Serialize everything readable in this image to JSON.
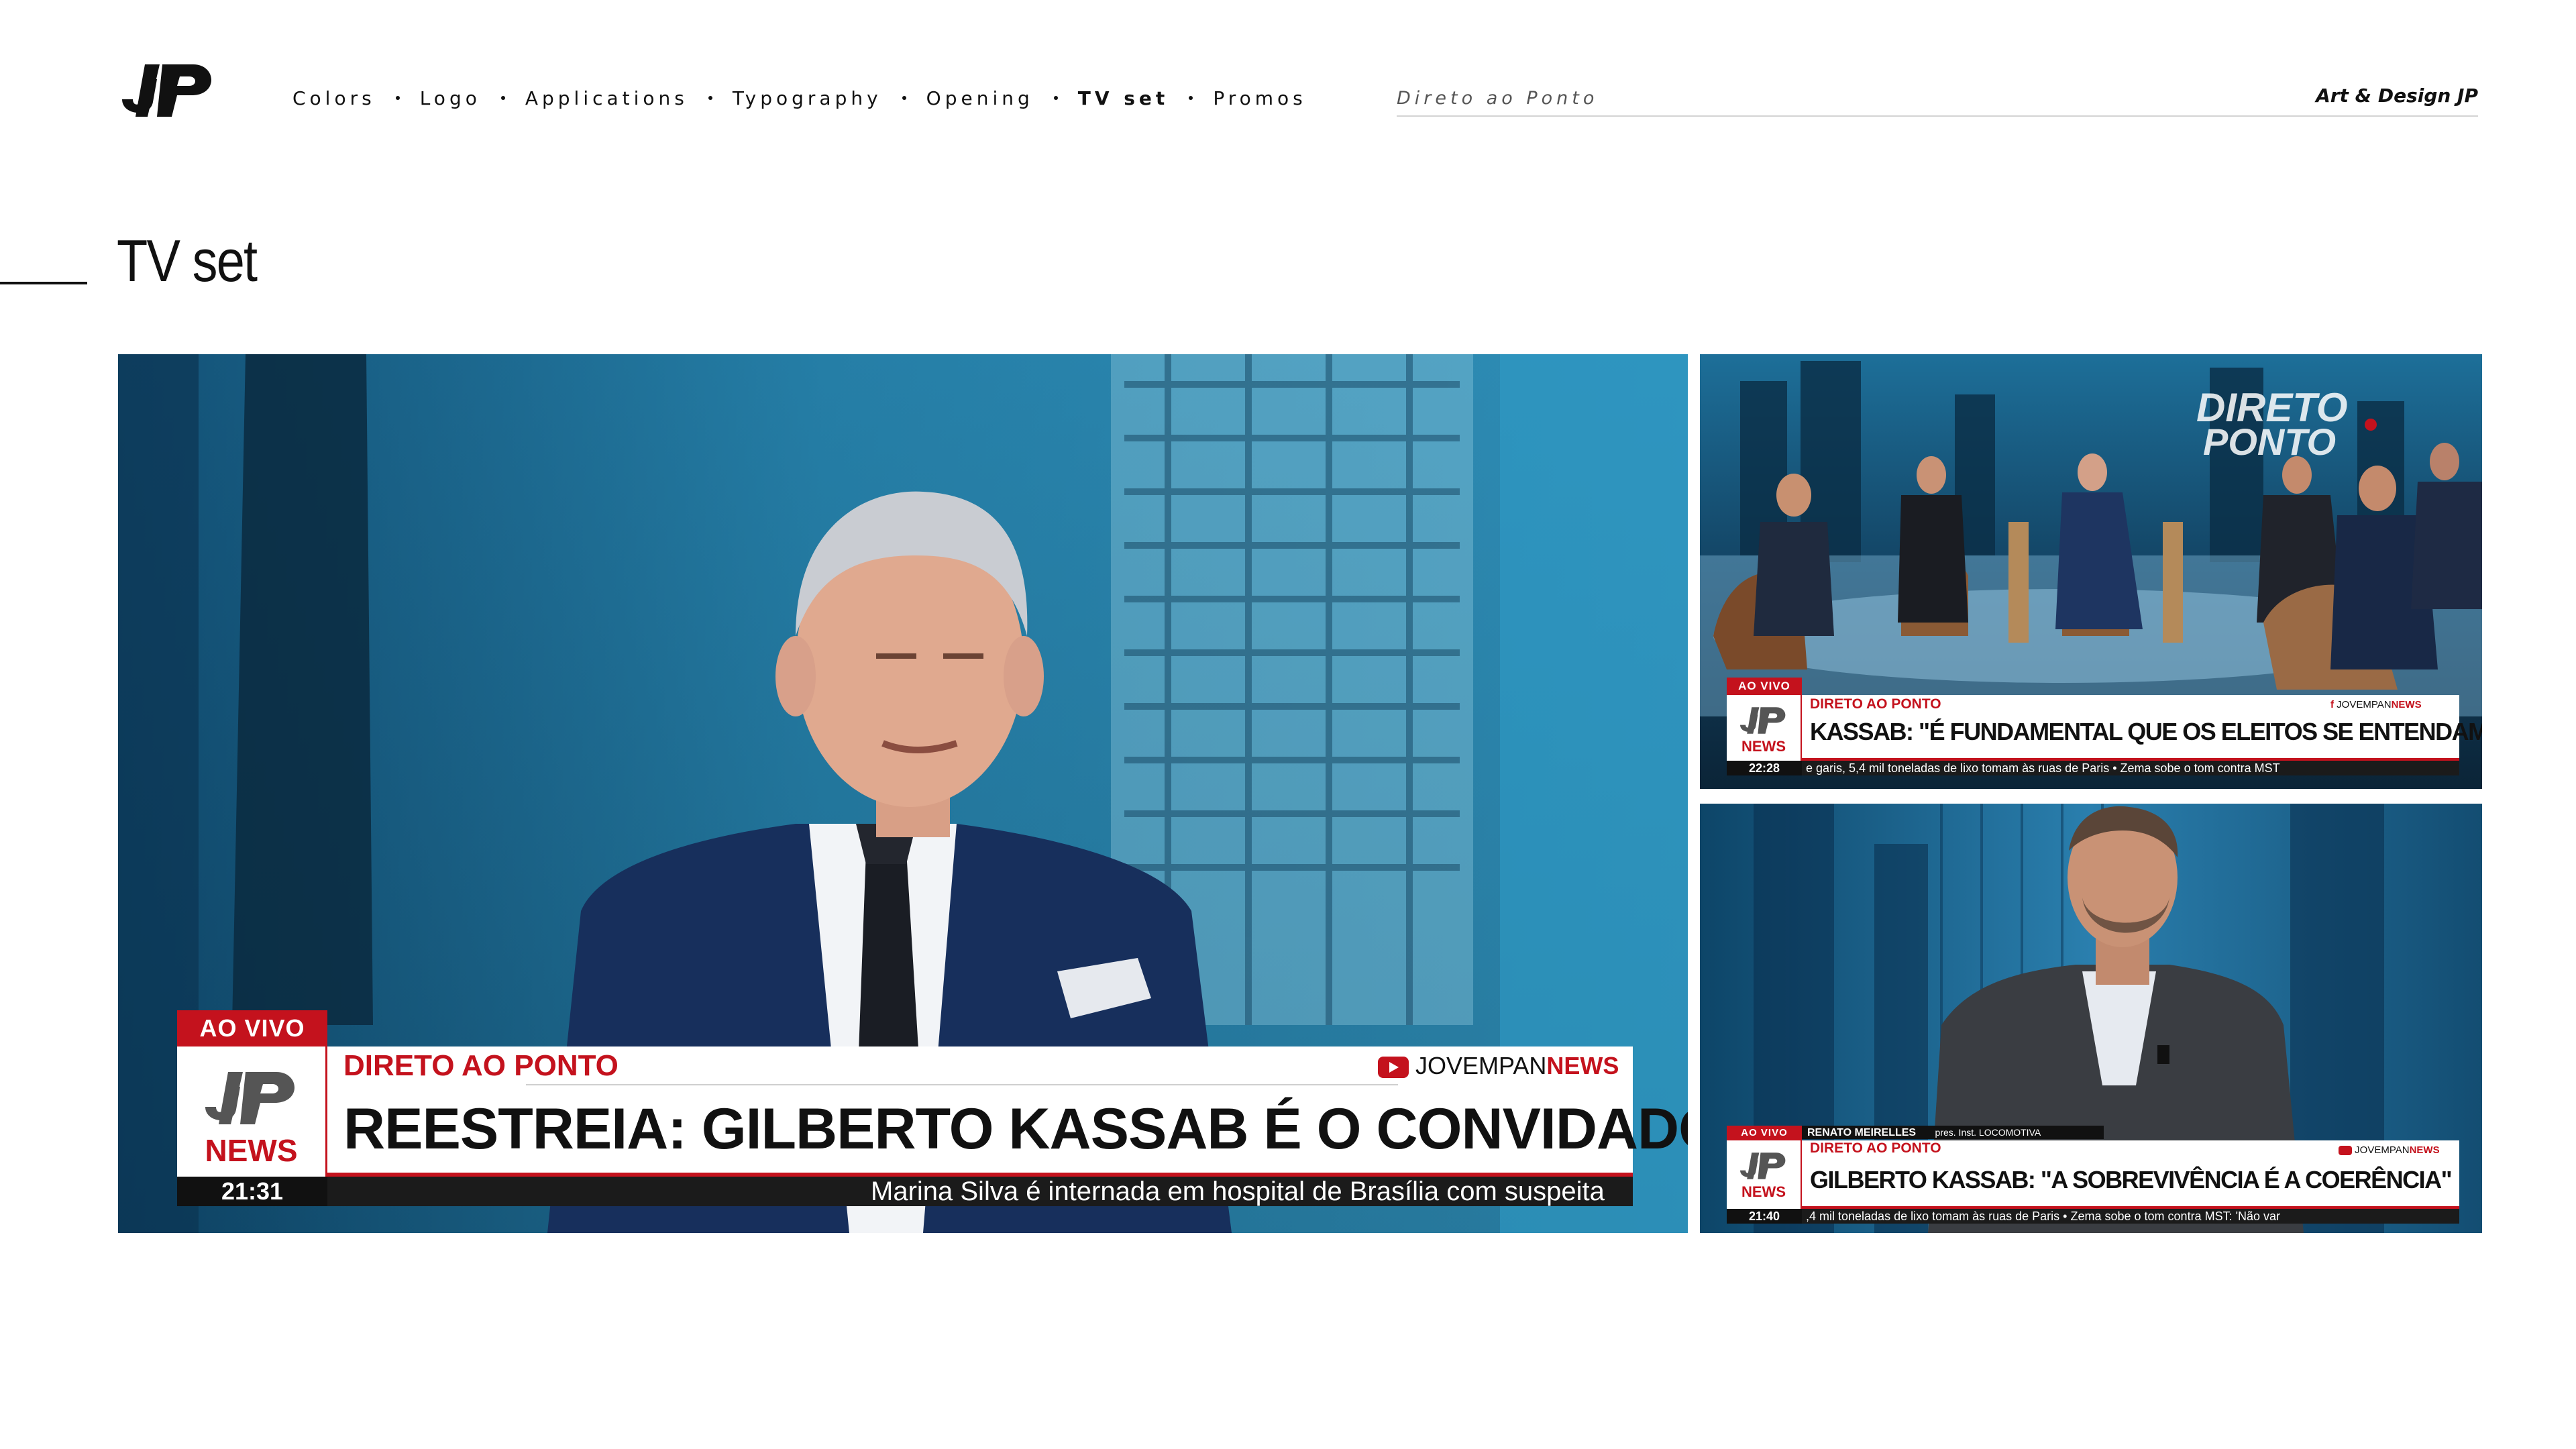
{
  "header": {
    "logo_name": "jp-logo",
    "nav": [
      {
        "label": "Colors",
        "active": false
      },
      {
        "label": "Logo",
        "active": false
      },
      {
        "label": "Applications",
        "active": false
      },
      {
        "label": "Typography",
        "active": false
      },
      {
        "label": "Opening",
        "active": false
      },
      {
        "label": "TV set",
        "active": true
      },
      {
        "label": "Promos",
        "active": false
      }
    ],
    "search_placeholder": "Direto ao Ponto",
    "brand_link": "Art & Design JP"
  },
  "section": {
    "title": "TV set"
  },
  "frames": {
    "main": {
      "live": "AO VIVO",
      "bug_news": "NEWS",
      "clock": "21:31",
      "program": "DIRETO AO PONTO",
      "brand_prefix": "JOVEMPAN",
      "brand_suffix": "NEWS",
      "headline": "REESTREIA: GILBERTO KASSAB É O CONVIDADO ESPECIAL",
      "ticker": "Marina Silva é internada em hospital de Brasília com suspeita"
    },
    "top": {
      "live": "AO VIVO",
      "bug_news": "NEWS",
      "clock": "22:28",
      "program": "DIRETO AO PONTO",
      "brand_prefix": "JOVEMPAN",
      "brand_suffix": "NEWS",
      "headline": "KASSAB: \"É FUNDAMENTAL QUE OS ELEITOS SE ENTENDAM\"",
      "ticker": "e garis, 5,4 mil toneladas de lixo tomam às ruas de Paris • Zema sobe o tom contra MST",
      "set_logo_line1": "DIRETO",
      "set_logo_line2": "PONTO"
    },
    "bottom": {
      "live": "AO VIVO",
      "bug_news": "NEWS",
      "clock": "21:40",
      "program": "DIRETO AO PONTO",
      "brand_prefix": "JOVEMPAN",
      "brand_suffix": "NEWS",
      "headline": "GILBERTO KASSAB: \"A SOBREVIVÊNCIA É A COERÊNCIA\"",
      "ticker": ",4 mil toneladas de lixo tomam às ruas de Paris • Zema sobe o tom contra MST: 'Não var",
      "guest_name": "RENATO MEIRELLES",
      "guest_role": "pres. Inst. LOCOMOTIVA"
    }
  },
  "colors": {
    "brand_red": "#c4121d",
    "set_blue": "#1b6f9a",
    "text": "#111111"
  }
}
